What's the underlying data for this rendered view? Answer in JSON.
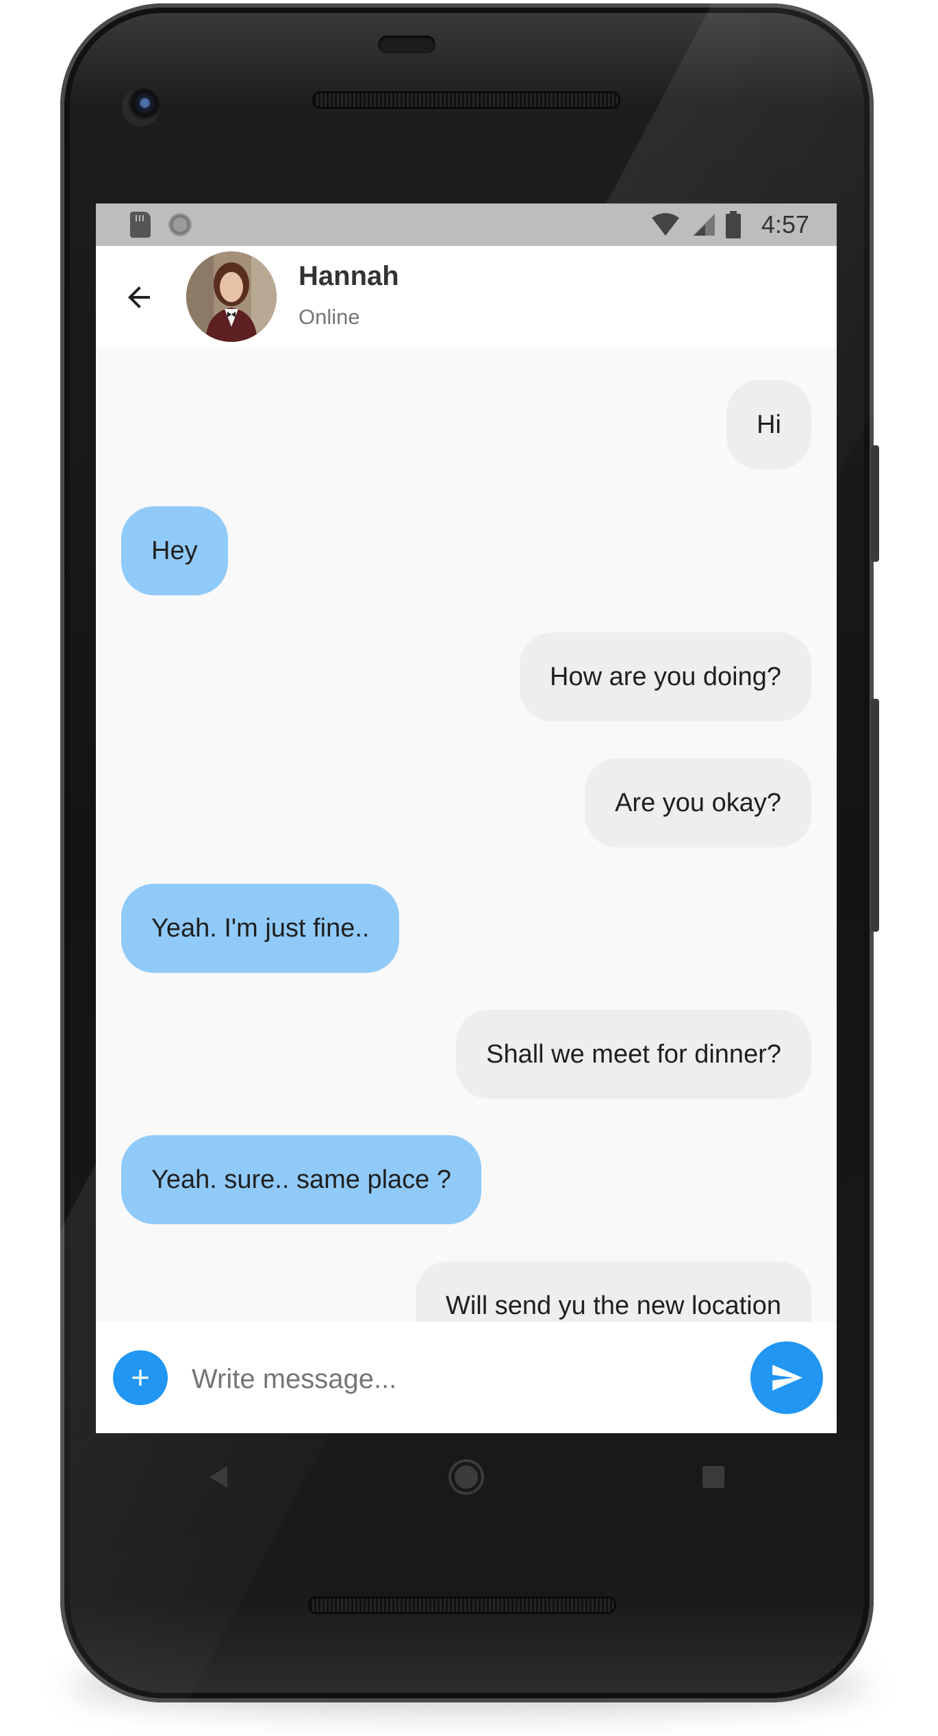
{
  "status_bar": {
    "time": "4:57",
    "icons": [
      "sd-card-icon",
      "sync-dot-icon",
      "wifi-icon",
      "signal-icon",
      "battery-icon"
    ]
  },
  "app_bar": {
    "back_icon": "arrow-back-icon",
    "contact": {
      "name": "Hannah",
      "status": "Online"
    }
  },
  "messages": [
    {
      "text": "Hi",
      "direction": "sent"
    },
    {
      "text": "Hey",
      "direction": "received"
    },
    {
      "text": "How are you doing?",
      "direction": "sent"
    },
    {
      "text": "Are you okay?",
      "direction": "sent"
    },
    {
      "text": "Yeah. I'm just fine..",
      "direction": "received"
    },
    {
      "text": "Shall we meet for dinner?",
      "direction": "sent"
    },
    {
      "text": "Yeah. sure.. same place ?",
      "direction": "received"
    },
    {
      "text": "Will send yu the new location",
      "direction": "sent"
    }
  ],
  "composer": {
    "placeholder": "Write message...",
    "value": "",
    "add_icon": "plus-icon",
    "send_icon": "send-icon"
  },
  "nav_bar": {
    "icons": [
      "nav-back-icon",
      "nav-home-icon",
      "nav-recents-icon"
    ]
  },
  "colors": {
    "accent": "#2196f3",
    "received_bubble": "#90caf9",
    "sent_bubble": "#eeeeee",
    "status_bar": "#bdbdbd",
    "chat_background": "#f9f9f9"
  }
}
